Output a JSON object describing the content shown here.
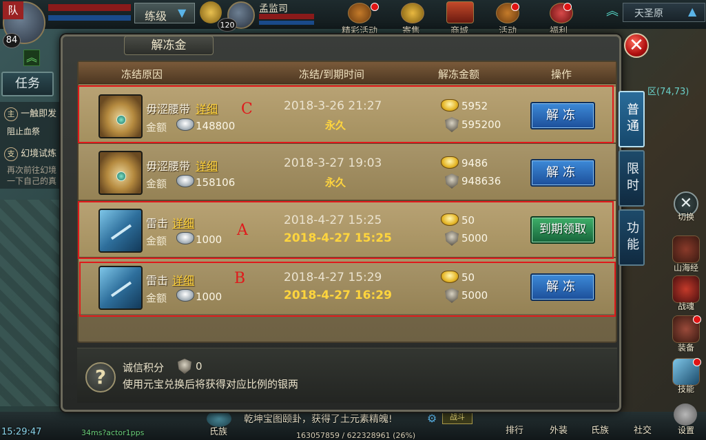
{
  "hud": {
    "player_level": "84",
    "team_label": "队",
    "practice_label": "练级",
    "target_name": "孟监司",
    "target_level": "120",
    "server_name": "天圣原",
    "menu_items": [
      "精彩活动",
      "寄售",
      "商城",
      "活动",
      "福利"
    ]
  },
  "quest": {
    "tab_label": "任务",
    "main_tag": "主",
    "main_title": "一触即发",
    "main_desc": "阻止血祭",
    "side_tag": "支",
    "side_title": "幻境试炼",
    "side_desc1": "再次前往幻境",
    "side_desc2": "一下自己的真"
  },
  "coords": "(74,73)",
  "right_icons": [
    "切换",
    "山海经",
    "战魂",
    "装备",
    "技能",
    "设置"
  ],
  "bottom": {
    "time": "15:29:47",
    "ping": "34ms?actor1pps",
    "clan": "氏族",
    "broadcast": "乾坤宝图颐卦，获得了土元素精魄!",
    "battle": "战斗",
    "exp": "163057859 / 622328961 (26%)",
    "buttons": [
      "排行",
      "外装",
      "氏族",
      "社交"
    ]
  },
  "dialog": {
    "title": "解冻金",
    "close": "✕",
    "headers": {
      "reason": "冻结原因",
      "time": "冻结/到期时间",
      "amount": "解冻金额",
      "action": "操作"
    },
    "rows": [
      {
        "name": "毋涩腰带",
        "detail": "详细",
        "amount_label": "金额",
        "silver": "148800",
        "time_top": "2018-3-26 21:27",
        "time_bottom": "永久",
        "gold": "5952",
        "bind": "595200",
        "button": "解冻",
        "icon": "belt-icon"
      },
      {
        "name": "毋涩腰带",
        "detail": "详细",
        "amount_label": "金额",
        "silver": "158106",
        "time_top": "2018-3-27 19:03",
        "time_bottom": "永久",
        "gold": "9486",
        "bind": "948636",
        "button": "解冻",
        "icon": "belt-icon"
      },
      {
        "name": "雷击",
        "detail": "详细",
        "amount_label": "金额",
        "silver": "1000",
        "time_top": "2018-4-27 15:25",
        "time_bottom": "2018-4-27 15:25",
        "gold": "50",
        "bind": "5000",
        "button": "到期领取",
        "icon": "book-icon"
      },
      {
        "name": "雷击",
        "detail": "详细",
        "amount_label": "金额",
        "silver": "1000",
        "time_top": "2018-4-27 15:29",
        "time_bottom": "2018-4-27 16:29",
        "gold": "50",
        "bind": "5000",
        "button": "解冻",
        "icon": "book-icon"
      }
    ],
    "side_tabs": [
      "普通",
      "限时",
      "功能"
    ],
    "active_tab": "普通",
    "annotations": [
      "C",
      "A",
      "B"
    ],
    "footer": {
      "credit_label": "诚信积分",
      "credit_value": "0",
      "note": "使用元宝兑换后将获得对应比例的银两",
      "help": "?"
    }
  },
  "colors": {
    "annotation_red": "#e0191b",
    "detail_link": "#ffd23a",
    "time_highlight": "#ffd53d",
    "button_blue": "#2a6cc0",
    "button_green": "#2a8a50"
  }
}
